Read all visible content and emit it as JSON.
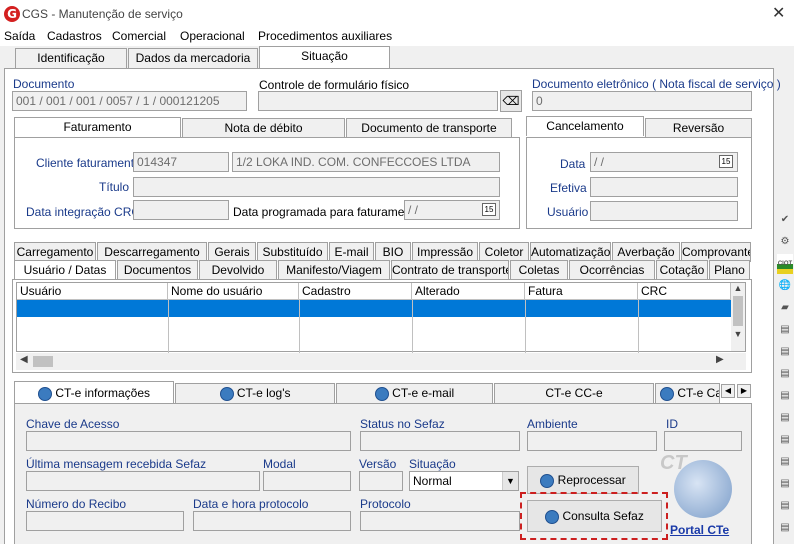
{
  "window": {
    "title": "CGS - Manutenção de serviço",
    "close": "✕"
  },
  "menu": [
    "Saída",
    "Cadastros",
    "Comercial",
    "Operacional",
    "Procedimentos auxiliares"
  ],
  "top_tabs": [
    "Identificação",
    "Dados da mercadoria",
    "Situação"
  ],
  "documento": {
    "label": "Documento",
    "value": "001 / 001 / 001 / 0057 / 1 / 000121205"
  },
  "controle": {
    "label": "Controle de formulário físico",
    "value": ""
  },
  "doc_eletronico": {
    "label": "Documento eletrônico ( Nota fiscal de serviço )",
    "value": "0"
  },
  "fat_tabs": [
    "Faturamento",
    "Nota de débito",
    "Documento de transporte"
  ],
  "cancel_tabs": [
    "Cancelamento",
    "Reversão"
  ],
  "faturamento": {
    "cliente_label": "Cliente faturamento",
    "cliente_code": "014347",
    "cliente_name": "1/2 LOKA IND. COM. CONFECCOES LTDA",
    "titulo_label": "Título",
    "data_integ_label": "Data integração CRC",
    "data_prog_label": "Data programada para faturamento",
    "data_prog_value": "/ /"
  },
  "cancelamento": {
    "data_label": "Data",
    "data_value": "/ /",
    "efetiva_label": "Efetiva",
    "usuario_label": "Usuário"
  },
  "tabs_row1": [
    "Carregamento",
    "Descarregamento",
    "Gerais",
    "Substituído",
    "E-mail",
    "BIO",
    "Impressão",
    "Coletor",
    "Automatização",
    "Averbação",
    "Comprovante"
  ],
  "tabs_row2": [
    "Usuário / Datas",
    "Documentos",
    "Devolvido",
    "Manifesto/Viagem",
    "Contrato de transporte",
    "Coletas",
    "Ocorrências",
    "Cotação",
    "Plano"
  ],
  "grid_columns": [
    "Usuário",
    "Nome do usuário",
    "Cadastro",
    "Alterado",
    "Fatura",
    "CRC"
  ],
  "cte_tabs": [
    "CT-e informações",
    "CT-e log's",
    "CT-e e-mail",
    "CT-e CC-e",
    "CT-e Ca"
  ],
  "cte": {
    "chave_label": "Chave de Acesso",
    "status_label": "Status no Sefaz",
    "ambiente_label": "Ambiente",
    "id_label": "ID",
    "ultima_label": "Última mensagem recebida Sefaz",
    "modal_label": "Modal",
    "versao_label": "Versão",
    "situacao_label": "Situação",
    "situacao_value": "Normal",
    "recibo_label": "Número do Recibo",
    "datahora_label": "Data e hora protocolo",
    "protocolo_label": "Protocolo",
    "reprocessar": "Reprocessar",
    "consulta": "Consulta Sefaz",
    "portal": "Portal CTe",
    "logo_text": "CT"
  },
  "sidebar_tools": [
    "✔",
    "⚙",
    "CIOT",
    "🌐",
    "▰",
    "▤",
    "▤",
    "▤",
    "▤",
    "▤",
    "▤",
    "▤",
    "▤",
    "▤",
    "▤",
    "▤"
  ]
}
